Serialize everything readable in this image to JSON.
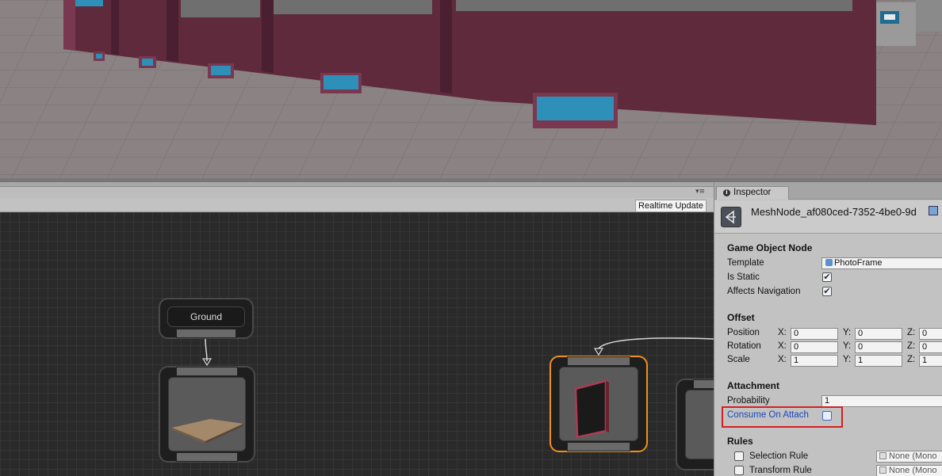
{
  "graph": {
    "toolbar_menu_icon": "▾≡",
    "realtime_update_label": "Realtime Update",
    "nodes": [
      {
        "label": "Ground"
      }
    ]
  },
  "inspector": {
    "tab_label": "Inspector",
    "tab_icon": "info-icon",
    "object_name": "MeshNode_af080ced-7352-4be0-9d",
    "sections": {
      "game_object_node": "Game Object Node",
      "offset": "Offset",
      "attachment": "Attachment",
      "rules": "Rules"
    },
    "template": {
      "label": "Template",
      "value": "PhotoFrame"
    },
    "is_static": {
      "label": "Is Static",
      "checked": true
    },
    "affects_navigation": {
      "label": "Affects Navigation",
      "checked": true
    },
    "position": {
      "label": "Position",
      "x": "0",
      "y": "0",
      "z": "0"
    },
    "rotation": {
      "label": "Rotation",
      "x": "0",
      "y": "0",
      "z": "0"
    },
    "scale": {
      "label": "Scale",
      "x": "1",
      "y": "1",
      "z": "1"
    },
    "axis_labels": {
      "x": "X:",
      "y": "Y:",
      "z": "Z:"
    },
    "probability": {
      "label": "Probability",
      "value": "1"
    },
    "consume_on_attach": {
      "label": "Consume On Attach",
      "checked": false
    },
    "selection_rule": {
      "label": "Selection Rule",
      "value": "None (Mono"
    },
    "transform_rule": {
      "label": "Transform Rule",
      "value": "None (Mono"
    },
    "check_glyph": "✔"
  },
  "colors": {
    "highlight": "#d42020",
    "selected_node_outline": "#f0901a",
    "wall": "#5e2a3c",
    "window": "#2e8fb8"
  }
}
